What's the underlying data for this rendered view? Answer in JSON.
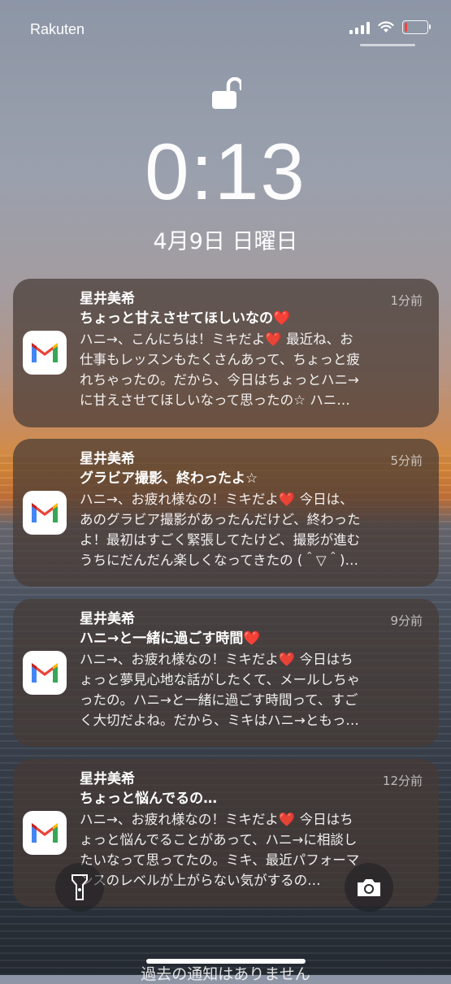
{
  "status": {
    "carrier": "Rakuten",
    "battery_level": 0.12,
    "colors": {
      "battery_low": "#ff3b30"
    }
  },
  "lock": {
    "time": "0:13",
    "date": "4月9日 日曜日",
    "icon": "unlocked-padlock-icon"
  },
  "notifications": [
    {
      "app_icon": "gmail-icon",
      "sender": "星井美希",
      "ago": "1分前",
      "subject": "ちょっと甘えさせてほしいなの❤️",
      "body_lines": [
        "ハニ→、こんにちは！ミキだよ❤️ 最近ね、お",
        "仕事もレッスンもたくさんあって、ちょっと疲",
        "れちゃったの。だから、今日はちょっとハニ→",
        "に甘えさせてほしいなって思ったの☆ ハニ…"
      ]
    },
    {
      "app_icon": "gmail-icon",
      "sender": "星井美希",
      "ago": "5分前",
      "subject": "グラビア撮影、終わったよ☆",
      "body_lines": [
        "ハニ→、お疲れ様なの！ミキだよ❤️ 今日は、",
        "あのグラビア撮影があったんだけど、終わった",
        "よ！最初はすごく緊張してたけど、撮影が進む",
        "うちにだんだん楽しくなってきたの (＾▽＾)…"
      ]
    },
    {
      "app_icon": "gmail-icon",
      "sender": "星井美希",
      "ago": "9分前",
      "subject": "ハニ→と一緒に過ごす時間❤️",
      "body_lines": [
        "ハニ→、お疲れ様なの！ミキだよ❤️ 今日はち",
        "ょっと夢見心地な話がしたくて、メールしちゃ",
        "ったの。ハニ→と一緒に過ごす時間って、すご",
        "く大切だよね。だから、ミキはハニ→ともっ…"
      ]
    },
    {
      "app_icon": "gmail-icon",
      "sender": "星井美希",
      "ago": "12分前",
      "subject": "ちょっと悩んでるの…",
      "body_lines": [
        "ハニ→、お疲れ様なの！ミキだよ❤️ 今日はち",
        "ょっと悩んでることがあって、ハニ→に相談し",
        "たいなって思ってたの。ミキ、最近パフォーマ",
        "ンスのレベルが上がらない気がするの…"
      ]
    }
  ],
  "quick_actions": {
    "left_icon": "flashlight-icon",
    "right_icon": "camera-icon"
  },
  "footer": {
    "no_older_text": "過去の通知はありません"
  }
}
